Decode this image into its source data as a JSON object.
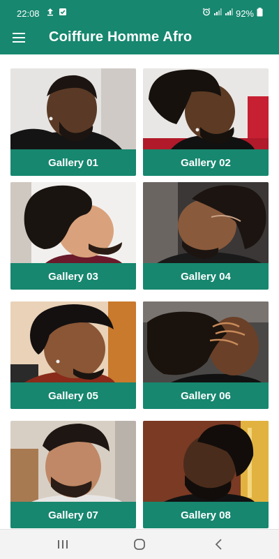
{
  "status_bar": {
    "time": "22:08",
    "battery": "92%"
  },
  "app_bar": {
    "title": "Coiffure Homme Afro",
    "menu_icon": "hamburger-menu-icon"
  },
  "galleries": [
    {
      "label": "Gallery 01"
    },
    {
      "label": "Gallery 02"
    },
    {
      "label": "Gallery 03"
    },
    {
      "label": "Gallery 04"
    },
    {
      "label": "Gallery 05"
    },
    {
      "label": "Gallery 06"
    },
    {
      "label": "Gallery 07"
    },
    {
      "label": "Gallery 08"
    }
  ],
  "nav_bar": {
    "icons": [
      "recents-icon",
      "home-icon",
      "back-icon"
    ]
  },
  "colors": {
    "primary": "#17876f",
    "nav_background": "#f3f3f3"
  }
}
